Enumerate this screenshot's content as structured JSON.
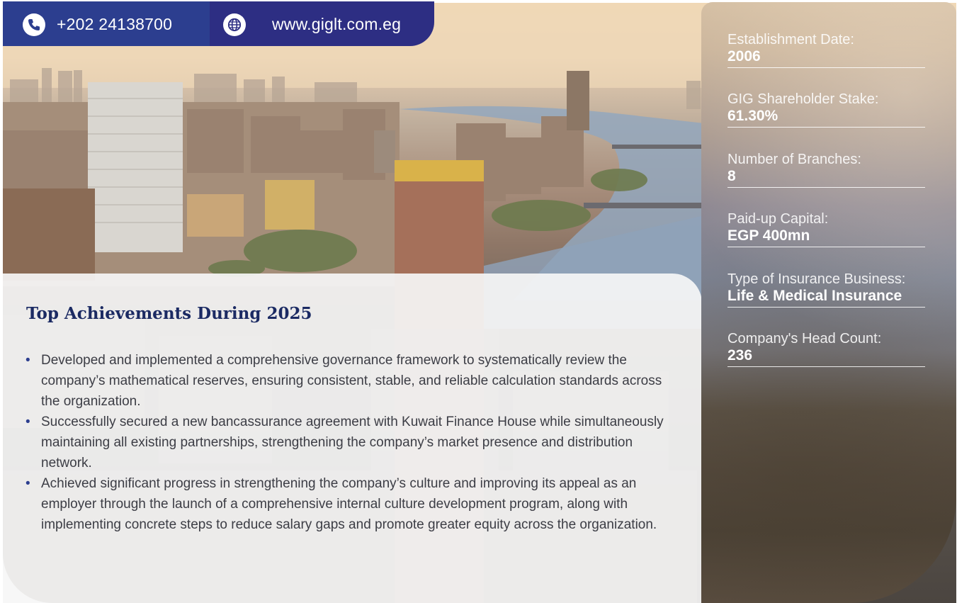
{
  "contact": {
    "phone": "+202 24138700",
    "website": "www.giglt.com.eg",
    "phone_icon": "phone-icon",
    "globe_icon": "globe-icon",
    "colors": {
      "phone_bg": "#2c3e8f",
      "web_bg": "#2d2e83"
    }
  },
  "achievements": {
    "title": "Top Achievements During 2025",
    "items": [
      "Developed and implemented a comprehensive governance framework to systematically review the company’s mathematical reserves, ensuring consistent, stable, and reliable calculation standards across the organization.",
      "Successfully secured a new bancassurance agreement with Kuwait Finance House while simultaneously maintaining all existing partnerships, strengthening the company’s market presence and distribution network.",
      "Achieved significant progress in strengthening the company’s culture and improving its appeal as an employer through the launch of a comprehensive internal culture development program, along with implementing concrete steps to reduce salary gaps and promote greater equity across the organization."
    ]
  },
  "facts": [
    {
      "label": "Establishment Date:",
      "value": "2006"
    },
    {
      "label": "GIG Shareholder Stake:",
      "value": "61.30%"
    },
    {
      "label": "Number of Branches:",
      "value": "8"
    },
    {
      "label": "Paid-up Capital:",
      "value": "EGP 400mn"
    },
    {
      "label": "Type of Insurance Business:",
      "value": "Life & Medical Insurance"
    },
    {
      "label": "Company's Head Count:",
      "value": "236"
    }
  ],
  "colors": {
    "accent": "#1b2a63",
    "bullet": "#2c3e8f",
    "text": "#3c3d45"
  }
}
